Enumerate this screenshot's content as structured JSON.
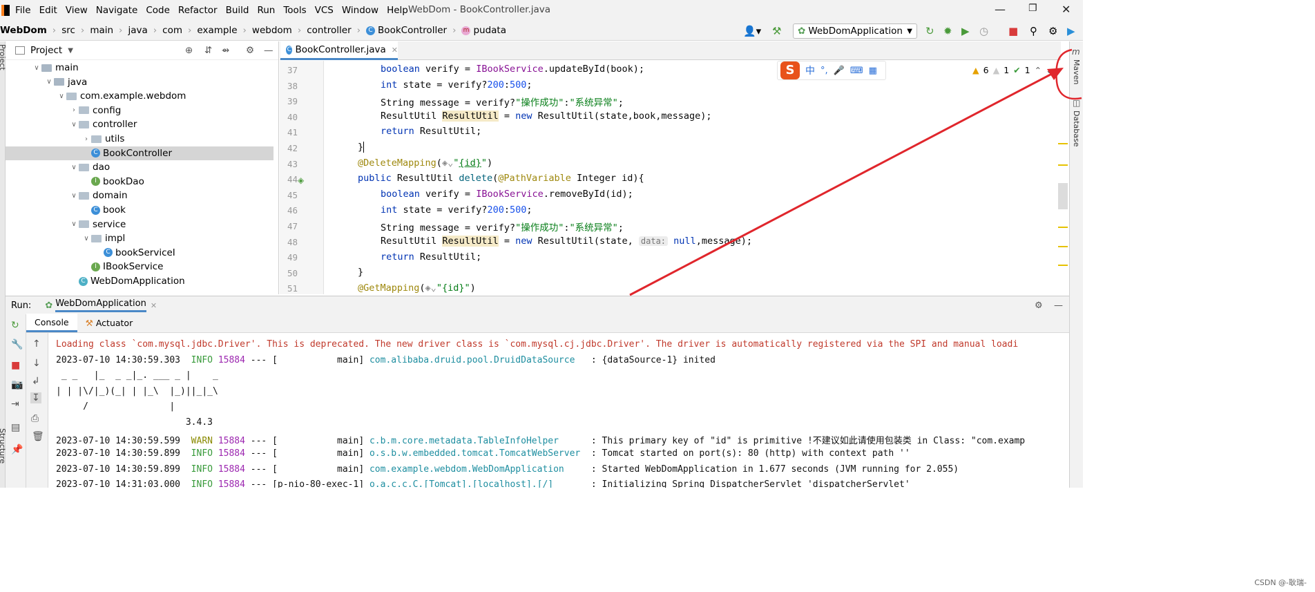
{
  "menubar": {
    "items": [
      "File",
      "Edit",
      "View",
      "Navigate",
      "Code",
      "Refactor",
      "Build",
      "Run",
      "Tools",
      "VCS",
      "Window",
      "Help"
    ],
    "window_title": "WebDom - BookController.java"
  },
  "breadcrumb": {
    "items": [
      "WebDom",
      "src",
      "main",
      "java",
      "com",
      "example",
      "webdom",
      "controller",
      "BookController",
      "pudata"
    ]
  },
  "run_config": {
    "label": "WebDomApplication"
  },
  "project_panel": {
    "title": "Project",
    "tree": [
      {
        "label": "main",
        "kind": "folder",
        "arrow": "down"
      },
      {
        "label": "java",
        "kind": "folder",
        "arrow": "down"
      },
      {
        "label": "com.example.webdom",
        "kind": "package",
        "arrow": "down"
      },
      {
        "label": "config",
        "kind": "package",
        "arrow": "right"
      },
      {
        "label": "controller",
        "kind": "package",
        "arrow": "down"
      },
      {
        "label": "utils",
        "kind": "package",
        "arrow": "right"
      },
      {
        "label": "BookController",
        "kind": "class",
        "selected": true
      },
      {
        "label": "dao",
        "kind": "package",
        "arrow": "down"
      },
      {
        "label": "bookDao",
        "kind": "interface"
      },
      {
        "label": "domain",
        "kind": "package",
        "arrow": "down"
      },
      {
        "label": "book",
        "kind": "class"
      },
      {
        "label": "service",
        "kind": "package",
        "arrow": "down"
      },
      {
        "label": "impl",
        "kind": "package",
        "arrow": "down"
      },
      {
        "label": "bookServiceI",
        "kind": "class"
      },
      {
        "label": "IBookService",
        "kind": "interface"
      },
      {
        "label": "WebDomApplication",
        "kind": "app"
      }
    ]
  },
  "editor": {
    "tab_label": "BookController.java",
    "line_numbers": [
      "37",
      "38",
      "39",
      "40",
      "41",
      "42",
      "43",
      "44",
      "45",
      "46",
      "47",
      "48",
      "49",
      "50",
      "51"
    ],
    "inspections": {
      "warnings": "6",
      "weak_warnings": "1",
      "typos": "1"
    },
    "param_hint": "data:"
  },
  "ime": {
    "logo": "S",
    "lang": "中"
  },
  "right_tools": {
    "maven": "Maven",
    "database": "Database"
  },
  "left_tools": {
    "project": "Project",
    "structure": "Structure"
  },
  "run_panel": {
    "label": "Run:",
    "tab": "WebDomApplication",
    "subtabs": [
      "Console",
      "Actuator"
    ],
    "lines": [
      {
        "type": "err",
        "text": "Loading class `com.mysql.jdbc.Driver'. This is deprecated. The new driver class is `com.mysql.cj.jdbc.Driver'. The driver is automatically registered via the SPI and manual loadi"
      },
      {
        "type": "log",
        "ts": "2023-07-10 14:30:59.303",
        "level": "INFO",
        "pid": "15884",
        "thread": "--- [           main]",
        "cls": "com.alibaba.druid.pool.DruidDataSource",
        "msg": "   : {dataSource-1} inited"
      },
      {
        "type": "plain",
        "text": " _ _   |_  _ _|_. ___ _ |    _"
      },
      {
        "type": "plain",
        "text": "| | |\\/|_)(_| | |_\\  |_)||_|_\\"
      },
      {
        "type": "plain",
        "text": "     /               |"
      },
      {
        "type": "plain",
        "text": "                        3.4.3"
      },
      {
        "type": "log",
        "ts": "2023-07-10 14:30:59.599",
        "level": "WARN",
        "pid": "15884",
        "thread": "--- [           main]",
        "cls": "c.b.m.core.metadata.TableInfoHelper",
        "msg": "      : This primary key of \"id\" is primitive !不建议如此请使用包装类 in Class: \"com.examp"
      },
      {
        "type": "log",
        "ts": "2023-07-10 14:30:59.899",
        "level": "INFO",
        "pid": "15884",
        "thread": "--- [           main]",
        "cls": "o.s.b.w.embedded.tomcat.TomcatWebServer",
        "msg": "  : Tomcat started on port(s): 80 (http) with context path ''"
      },
      {
        "type": "log",
        "ts": "2023-07-10 14:30:59.899",
        "level": "INFO",
        "pid": "15884",
        "thread": "--- [           main]",
        "cls": "com.example.webdom.WebDomApplication",
        "msg": "     : Started WebDomApplication in 1.677 seconds (JVM running for 2.055)"
      },
      {
        "type": "log",
        "ts": "2023-07-10 14:31:03.000",
        "level": "INFO",
        "pid": "15884",
        "thread": "--- [p-nio-80-exec-1]",
        "cls": "o.a.c.c.C.[Tomcat].[localhost].[/]",
        "msg": "       : Initializing Spring DispatcherServlet 'dispatcherServlet'"
      }
    ]
  },
  "watermark": "CSDN @-耿瑞-",
  "colors": {
    "accent": "#4a88c7",
    "annotation_arrow": "#e0262c"
  }
}
